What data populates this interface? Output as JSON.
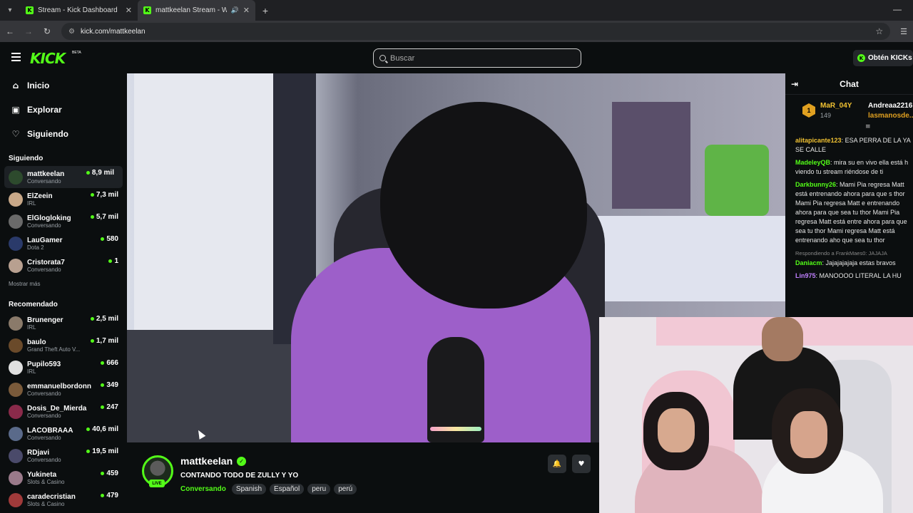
{
  "browser": {
    "tabs": [
      {
        "title": "Stream - Kick Dashboard"
      },
      {
        "title": "mattkeelan Stream - Watch"
      }
    ],
    "url": "kick.com/mattkeelan"
  },
  "header": {
    "logo": "KICK",
    "beta": "BETA",
    "search_placeholder": "Buscar",
    "get_kicks": "Obtén KICKs"
  },
  "sidebar": {
    "nav": [
      {
        "label": "Inicio",
        "icon": "home-icon"
      },
      {
        "label": "Explorar",
        "icon": "browse-icon"
      },
      {
        "label": "Siguiendo",
        "icon": "heart-icon"
      }
    ],
    "following_title": "Siguiendo",
    "following": [
      {
        "name": "mattkeelan",
        "sub": "Conversando",
        "viewers": "8,9 mil",
        "color": "#2d4a2d"
      },
      {
        "name": "ElZeein",
        "sub": "IRL",
        "viewers": "7,3 mil",
        "color": "#c8a888"
      },
      {
        "name": "ElGlogloking",
        "sub": "Conversando",
        "viewers": "5,7 mil",
        "color": "#6a6a6a"
      },
      {
        "name": "LauGamer",
        "sub": "Dota 2",
        "viewers": "580",
        "color": "#2a3a6a"
      },
      {
        "name": "Cristorata7",
        "sub": "Conversando",
        "viewers": "1",
        "color": "#b8a090"
      }
    ],
    "show_more": "Mostrar más",
    "recommended_title": "Recomendado",
    "recommended": [
      {
        "name": "Brunenger",
        "sub": "IRL",
        "viewers": "2,5 mil",
        "color": "#8a7a6a"
      },
      {
        "name": "baulo",
        "sub": "Grand Theft Auto V...",
        "viewers": "1,7 mil",
        "color": "#6a4a2a"
      },
      {
        "name": "Pupilo593",
        "sub": "IRL",
        "viewers": "666",
        "color": "#e0e0e0"
      },
      {
        "name": "emmanuelbordonn",
        "sub": "Conversando",
        "viewers": "349",
        "color": "#7a5a3a"
      },
      {
        "name": "Dosis_De_Mierda",
        "sub": "Conversando",
        "viewers": "247",
        "color": "#8a2a4a"
      },
      {
        "name": "LACOBRAAA",
        "sub": "Conversando",
        "viewers": "40,6 mil",
        "color": "#5a6a8a"
      },
      {
        "name": "RDjavi",
        "sub": "Conversando",
        "viewers": "19,5 mil",
        "color": "#4a4a6a"
      },
      {
        "name": "Yukineta",
        "sub": "Slots & Casino",
        "viewers": "459",
        "color": "#9a7a8a"
      },
      {
        "name": "caradecristian",
        "sub": "Slots & Casino",
        "viewers": "479",
        "color": "#a03a3a"
      }
    ]
  },
  "stream": {
    "streamer": "mattkeelan",
    "live_label": "LIVE",
    "title": "CONTANDO TODO DE ZULLY Y YO",
    "category": "Conversando",
    "tags": [
      "Spanish",
      "Español",
      "peru",
      "perú"
    ]
  },
  "chat": {
    "title": "Chat",
    "pinned": {
      "rank": "1",
      "user1": "MaR_04Y",
      "points": "149",
      "user2": "Andreaa2216",
      "user3": "lasmanosde..."
    },
    "messages": [
      {
        "user": "alitapicante123",
        "color": "#f1c232",
        "text": "ESA PERRA DE LA YA SE CALLE"
      },
      {
        "user": "MadeleyQB",
        "color": "#53fc18",
        "text": "mira su en vivo ella está h viendo tu stream riéndose de ti"
      },
      {
        "user": "Darkbunny26",
        "color": "#53fc18",
        "text": "Mami Pia regresa Matt está entrenando ahora para que s thor Mami Pia regresa Matt e entrenando ahora para que sea tu thor Mami Pia regresa Matt está entre ahora para que sea tu thor Mami regresa Matt está entrenando aho que sea tu thor"
      },
      {
        "reply": "Respondiendo a FrankMaes0: JAJAJA",
        "user": "Daniacm",
        "color": "#53fc18",
        "text": "Jajajajajaja estas bravos"
      },
      {
        "user": "Lin975",
        "color": "#c080ff",
        "text": "MANOOOO LITERAL LA HU"
      }
    ]
  }
}
